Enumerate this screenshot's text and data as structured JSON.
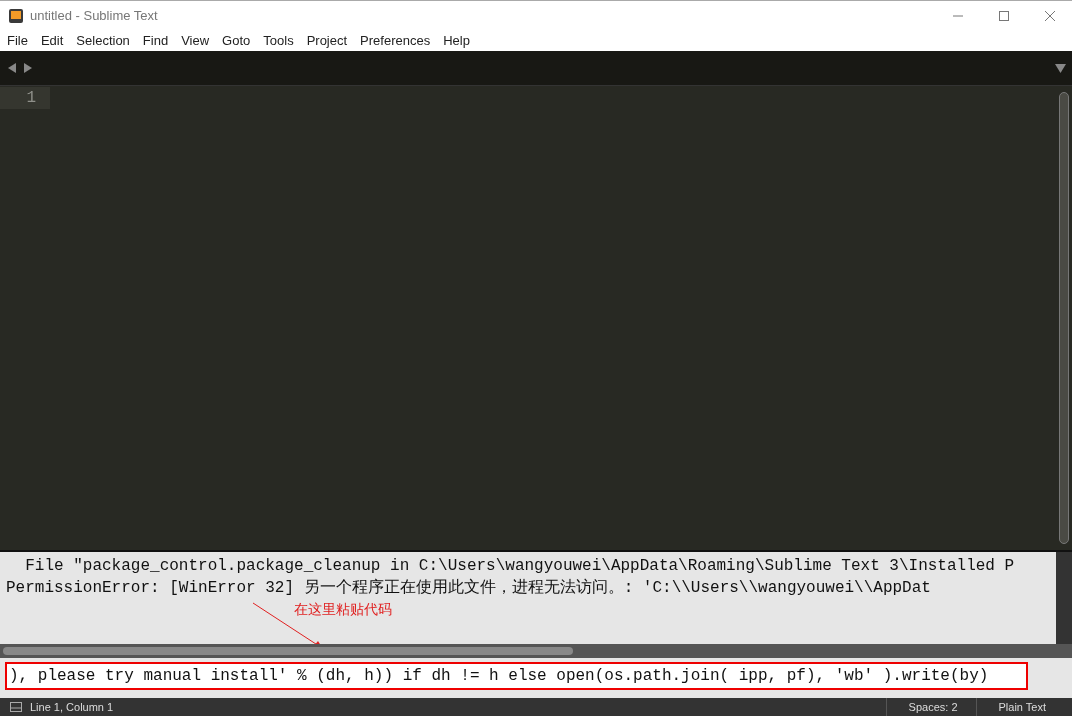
{
  "window": {
    "title": "untitled - Sublime Text"
  },
  "menu": [
    "File",
    "Edit",
    "Selection",
    "Find",
    "View",
    "Goto",
    "Tools",
    "Project",
    "Preferences",
    "Help"
  ],
  "editor": {
    "line_numbers": [
      "1"
    ]
  },
  "console": {
    "lines": [
      "  File \"package_control.package_cleanup in C:\\Users\\wangyouwei\\AppData\\Roaming\\Sublime Text 3\\Installed P",
      "PermissionError: [WinError 32] 另一个程序正在使用此文件，进程无法访问。: 'C:\\\\Users\\\\wangyouwei\\\\AppDat"
    ],
    "annotation": "在这里粘贴代码",
    "input": "), please try manual install' % (dh, h)) if dh != h else open(os.path.join( ipp, pf), 'wb' ).write(by)"
  },
  "status_bar": {
    "position": "Line 1, Column 1",
    "indentation": "Spaces: 2",
    "syntax": "Plain Text"
  }
}
